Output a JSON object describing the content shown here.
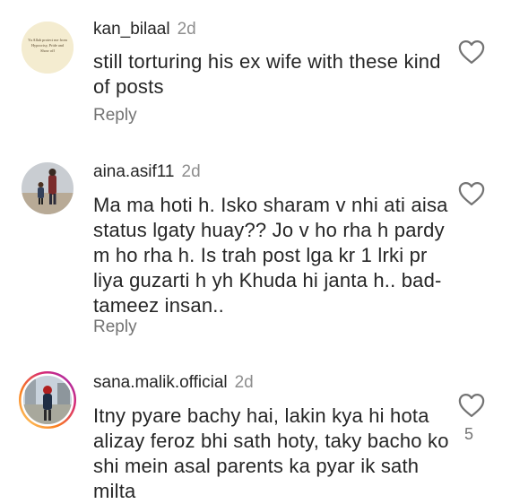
{
  "comments": [
    {
      "username": "kan_bilaal",
      "time": "2d",
      "text": "still torturing his ex wife with these kind of posts",
      "reply_label": "Reply",
      "avatar_caption": "Ya Allah protect me from Hypocrisy, Pride and Show off",
      "like_icon": "heart-outline-icon"
    },
    {
      "username": "aina.asif11",
      "time": "2d",
      "text": "Ma ma hoti h. Isko sharam v nhi ati aisa status lgaty huay?? Jo v ho rha h pardy m ho rha h. Is trah post lga kr 1 lrki pr liya guzarti h yh Khuda hi janta h.. bad-tameez insan..",
      "reply_label": "Reply",
      "like_icon": "heart-outline-icon"
    },
    {
      "username": "sana.malik.official",
      "time": "2d",
      "text": "Itny pyare bachy hai, lakin kya hi hota alizay feroz bhi sath hoty, taky bacho ko shi mein asal parents ka pyar ik sath milta",
      "like_count": "5",
      "like_icon": "heart-outline-icon",
      "story_ring_colors": [
        "#feda75",
        "#fa7e1e",
        "#d62976",
        "#962fbf"
      ]
    }
  ]
}
